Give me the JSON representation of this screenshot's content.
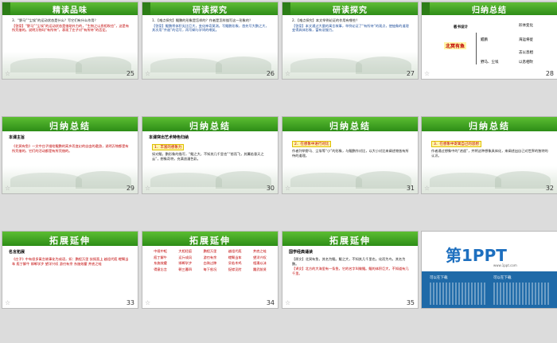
{
  "slides": [
    {
      "num": "25",
      "title": "精读品味",
      "lines": [
        "3．“野马”“尘埃”的运动状态是什么？写它们有什么作用？",
        "【答案】“野马”“尘埃”的运动状态是借助外力的，“生物之以息相吹也”，这是有所凭借的。说明万物均“有所待”，表现了庄子对“有所待”的否定。"
      ]
    },
    {
      "num": "26",
      "title": "研读探究",
      "lines": [
        "1．【难点探究】鲲鹏的形象是怎样的？作者是怎样描写这一形象的？",
        "【答案】鲲鹏将体积无比巨大，变化神奇莫测。写鲲鹏形象，首先写大鹏之大，其次用“齐谐”的话写，再写蜩与学鸠的嘲笑。"
      ]
    },
    {
      "num": "27",
      "title": "研读探究",
      "lines": [
        "2．【难点探究】本文举例论证的作用有哪些？",
        "【答案】本文通过大量的寓言故事，举例论证了“有所待”的观点，使抽象的道理变得具体形象，富有说服力。"
      ]
    },
    {
      "num": "28",
      "title": "归纳总结",
      "mindmap": {
        "label": "板书设计",
        "center": "北冥有鱼",
        "mid1": "鲲鹏",
        "mid2": "野马、尘埃",
        "r1": "形体变化",
        "r2": "海运将徙",
        "r3": "志以息相",
        "r4": "以息相吹"
      }
    },
    {
      "num": "29",
      "title": "归纳总结",
      "tag": "本课主旨",
      "lines": [
        "《北冥有鱼》一文中庄子描绘鲲鹏的离乡而变幻的自由的遨游，说明万物都是有所凭借的，它们的活动都是有所凭借的。"
      ]
    },
    {
      "num": "30",
      "title": "归纳总结",
      "tag": "本课突出艺术特色归纳",
      "highlight": "1．丰富的想象力",
      "lines": [
        "如对鲲，鹏形象的描写，“鲲之大，不知其几千里也”“怒而飞，其翼若垂天之云”，想象奇特，充满浪漫色彩。"
      ]
    },
    {
      "num": "31",
      "title": "归纳总结",
      "highlight": "2．在想象中进行对比",
      "lines": [
        "作者列举野马、尘埃等“小”的形象，与鲲鹏作对比，以大小对比来阐述物皆有所待的道理。"
      ]
    },
    {
      "num": "32",
      "title": "归纳总结",
      "highlight": "3．在想象中寄寓自己的思想",
      "lines": [
        "作者通过想象中的“逍遥”，并将这种想象具体化，来阐述出自己对世界的独特的认识。"
      ]
    },
    {
      "num": "33",
      "title": "拓展延伸",
      "tag": "名言拓展",
      "lines": [
        "《庄子》中有很多寓言故事化为成语，如：鹏程万里 扶摇直上 越俎代庖 螳臂当车 庖丁解牛 邯郸学步 望洋兴叹 游刃有余 东施效颦 井底之蛙"
      ]
    },
    {
      "num": "34",
      "title": "拓展延伸",
      "idioms": [
        "中规中矩",
        "大相径庭",
        "鹏程万里",
        "越俎代庖",
        "井底之蛙",
        "庖丁解牛",
        "运斤成风",
        "游刃有余",
        "螳臂当车",
        "望洋兴叹",
        "东施效颦",
        "邯郸学步",
        "白驹过隙",
        "呆若木鸡",
        "相濡以沫",
        "得意忘言",
        "朝三暮四",
        "每下愈况",
        "捉襟见肘",
        "踵武前贤"
      ]
    },
    {
      "num": "35",
      "title": "拓展延伸",
      "tag": "国学经典诵读",
      "lines": [
        "【原文】北冥有鱼，其名为鲲。鲲之大，不知其几千里也。化而为鸟，其名为鹏。",
        "【译文】北方的大海里有一条鱼，它的名字叫做鲲。鲲的体积巨大，不知道有几千里。"
      ]
    },
    {
      "num": "",
      "brand": {
        "big": "第1PPT",
        "small": "www.1ppt.com",
        "b1": "可以在下载",
        "b2": "可以在下载"
      }
    }
  ]
}
